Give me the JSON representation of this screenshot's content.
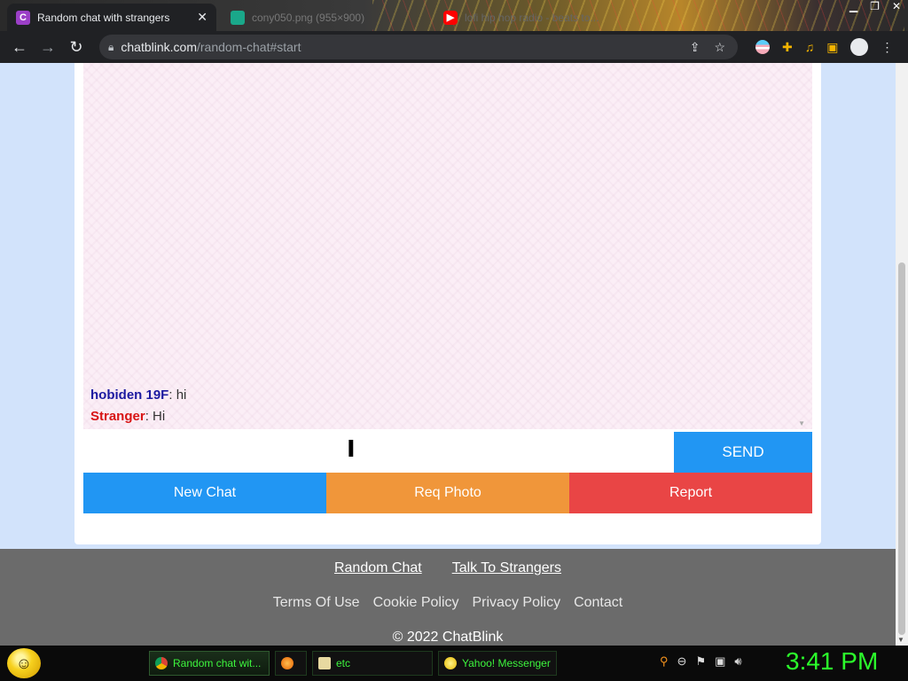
{
  "browser": {
    "tabs": [
      {
        "label": "Random chat with strangers",
        "favicon": "C",
        "active": true
      },
      {
        "label": "cony050.png (955×900)",
        "active": false
      },
      {
        "label": "lofi hip hop radio - beats to...",
        "active": false
      }
    ],
    "url_host": "chatblink.com",
    "url_path": "/random-chat#start"
  },
  "chat": {
    "messages": [
      {
        "nick": "hobiden 19F",
        "sep": ": ",
        "text": "hi",
        "role": "you"
      },
      {
        "nick": "Stranger",
        "sep": ": ",
        "text": "Hi",
        "role": "stranger"
      }
    ],
    "input_value": "",
    "send_label": "SEND"
  },
  "actions": {
    "new_chat": "New Chat",
    "req_photo": "Req Photo",
    "report": "Report"
  },
  "footer": {
    "primary_links": [
      "Random Chat",
      "Talk To Strangers"
    ],
    "secondary_links": [
      "Terms Of Use",
      "Cookie Policy",
      "Privacy Policy",
      "Contact"
    ],
    "copyright": "© 2022 ChatBlink"
  },
  "taskbar": {
    "tasks": [
      "Random chat wit...",
      "",
      "etc",
      "Yahoo! Messenger"
    ],
    "clock": "3:41 PM"
  },
  "colors": {
    "you_nick": "#1c1aa0",
    "stranger_nick": "#d81414",
    "send": "#2196f3",
    "new_chat": "#2196f3",
    "req_photo": "#f0963a",
    "report": "#e94545",
    "footer_bg": "#6b6b6b",
    "page_bg": "#d2e3fb",
    "chat_bg": "#fbeef6"
  }
}
